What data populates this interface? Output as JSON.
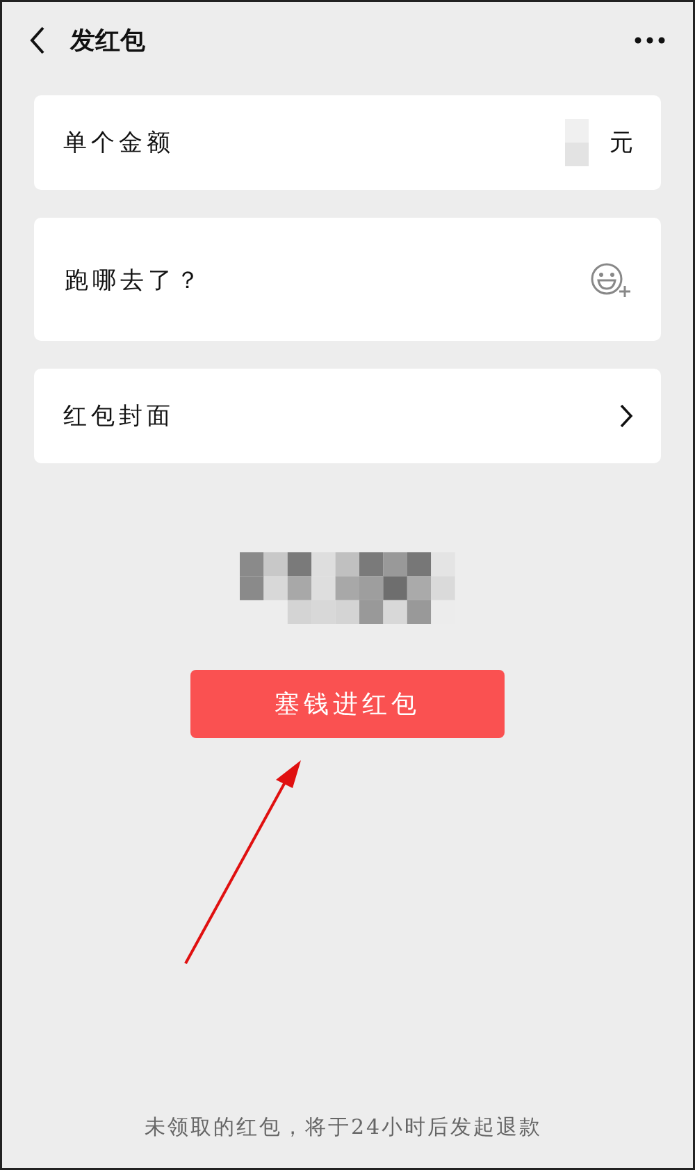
{
  "header": {
    "title": "发红包"
  },
  "amount": {
    "label": "单个金额",
    "unit": "元"
  },
  "message": {
    "placeholder": "跑哪去了？"
  },
  "cover": {
    "label": "红包封面"
  },
  "submit": {
    "label": "塞钱进红包"
  },
  "footer": {
    "note": "未领取的红包，将于24小时后发起退款"
  }
}
